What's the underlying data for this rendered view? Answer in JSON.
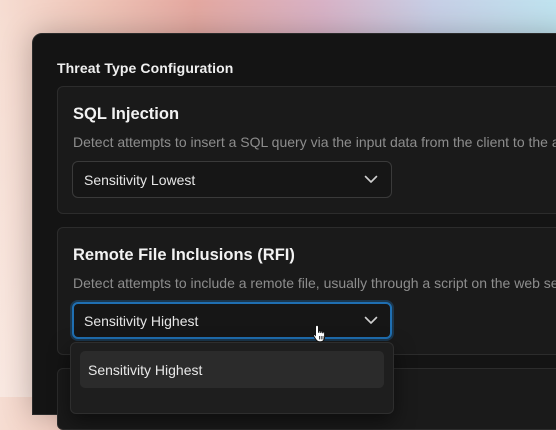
{
  "section": {
    "title": "Threat Type Configuration"
  },
  "cards": [
    {
      "title": "SQL Injection",
      "description": "Detect attempts to insert a SQL query via the input data from the client to the a",
      "sensitivity": "Sensitivity Lowest"
    },
    {
      "title": "Remote File Inclusions (RFI)",
      "description": "Detect attempts to include a remote file, usually through a script on the web se",
      "sensitivity": "Sensitivity Highest"
    }
  ],
  "dropdown": {
    "options": [
      "Sensitivity Highest"
    ],
    "highlighted": "Sensitivity Highest"
  },
  "icons": {
    "select_chevron": "chevron-down-icon",
    "cursor": "hand-pointer-cursor"
  },
  "colors": {
    "focus_ring": "#1f6fb2",
    "panel_bg": "#141414",
    "card_bg": "#1a1a1a"
  }
}
